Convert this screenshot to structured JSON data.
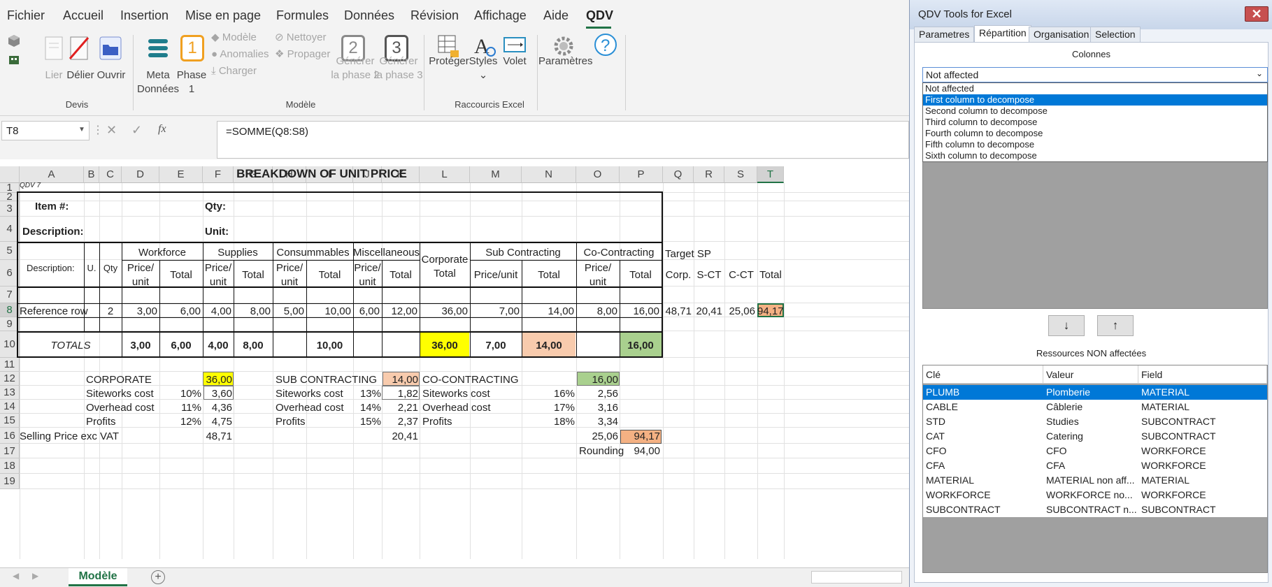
{
  "menu": [
    "Fichier",
    "Accueil",
    "Insertion",
    "Mise en page",
    "Formules",
    "Données",
    "Révision",
    "Affichage",
    "Aide",
    "QDV"
  ],
  "ribbon": {
    "devis": {
      "lier": "Lier",
      "delier": "Délier",
      "ouvrir": "Ouvrir",
      "group": "Devis"
    },
    "modele": {
      "meta1": "Meta",
      "meta2": "Données",
      "phase1a": "Phase",
      "phase1b": "1",
      "phase1_num": "1",
      "modele": "Modèle",
      "anomalies": "Anomalies",
      "charger": "Charger",
      "nettoyer": "Nettoyer",
      "propager": "Propager",
      "gen2a": "Générer",
      "gen2b": "la phase 2",
      "gen2_num": "2",
      "gen3a": "Générer",
      "gen3b": "la phase 3",
      "gen3_num": "3",
      "group": "Modèle"
    },
    "raccourcis": {
      "proteger": "Protéger",
      "styles": "Styles",
      "volet": "Volet",
      "group": "Raccourcis Excel"
    },
    "parametres": "Paramètres"
  },
  "formula_bar": {
    "name_box": "T8",
    "formula": "=SOMME(Q8:S8)",
    "fx": "fx"
  },
  "columns": [
    "A",
    "B",
    "C",
    "D",
    "E",
    "F",
    "G",
    "H",
    "I",
    "J",
    "K",
    "L",
    "M",
    "N",
    "O",
    "P",
    "Q",
    "R",
    "S",
    "T"
  ],
  "rows": [
    "1",
    "2",
    "3",
    "4",
    "5",
    "6",
    "7",
    "8",
    "9",
    "10",
    "11",
    "12",
    "13",
    "14",
    "15",
    "16",
    "17",
    "18",
    "19"
  ],
  "sheet": {
    "title": "BREAKDOWN OF UNIT PRICE",
    "qdv7": "QDV 7",
    "item": "Item #:",
    "qty": "Qty:",
    "description4": "Description:",
    "unit": "Unit:",
    "h_description": "Description:",
    "h_u": "U.",
    "h_qty": "Qty",
    "h_workforce": "Workforce",
    "h_supplies": "Supplies",
    "h_consumables": "Consummables",
    "h_misc": "Miscellaneous",
    "h_corp1": "Corporate",
    "h_corp2": "Total",
    "h_sub": "Sub Contracting",
    "h_co": "Co-Contracting",
    "h_target": "Target SP",
    "pu1": "Price/",
    "pu2": "unit",
    "total": "Total",
    "priceunit": "Price/unit",
    "corp": "Corp.",
    "sct": "S-CT",
    "cct": "C-CT",
    "ref_label": "Reference row",
    "ref_qty": "2",
    "ref": [
      "3,00",
      "6,00",
      "4,00",
      "8,00",
      "5,00",
      "10,00",
      "6,00",
      "12,00",
      "36,00",
      "7,00",
      "14,00",
      "8,00",
      "16,00",
      "48,71",
      "20,41",
      "25,06",
      "94,17"
    ],
    "totals_label": "TOTALS",
    "totals": [
      "3,00",
      "6,00",
      "4,00",
      "8,00",
      "10,00",
      "36,00",
      "7,00",
      "14,00",
      "16,00"
    ],
    "corporate": {
      "label": "CORPORATE",
      "value": "36,00",
      "sw": "Siteworks cost",
      "sw_pct": "10%",
      "sw_val": "3,60",
      "oh": "Overhead cost",
      "oh_pct": "11%",
      "oh_val": "4,36",
      "pr": "Profits",
      "pr_pct": "12%",
      "pr_val": "4,75",
      "sp_val": "48,71"
    },
    "subcontracting": {
      "label": "SUB CONTRACTING",
      "value": "14,00",
      "sw": "Siteworks cost",
      "sw_pct": "13%",
      "sw_val": "1,82",
      "oh": "Overhead cost",
      "oh_pct": "14%",
      "oh_val": "2,21",
      "pr": "Profits",
      "pr_pct": "15%",
      "pr_val": "2,37",
      "sp_val": "20,41"
    },
    "cocontracting": {
      "label": "CO-CONTRACTING",
      "value": "16,00",
      "sw": "Siteworks cost",
      "sw_pct": "16%",
      "sw_val": "2,56",
      "oh": "Overhead cost",
      "oh_pct": "17%",
      "oh_val": "3,16",
      "pr": "Profits",
      "pr_pct": "18%",
      "pr_val": "3,34",
      "sp_val": "25,06"
    },
    "selling": "Selling Price  exc VAT",
    "grand_total": "94,17",
    "rounding": "Rounding",
    "rounding_val": "94,00"
  },
  "sheet_tab": "Modèle",
  "panel": {
    "title": "QDV Tools for Excel",
    "close": "✕",
    "tabs": [
      "Parametres",
      "Répartition",
      "Organisation",
      "Selection"
    ],
    "colonnes": "Colonnes",
    "combo_value": "Not affected",
    "options": [
      "Not affected",
      "First column to decompose",
      "Second column to decompose",
      "Third column to decompose",
      "Fourth column to decompose",
      "Fifth column to decompose",
      "Sixth column to decompose"
    ],
    "down": "↓",
    "up": "↑",
    "ressources": "Ressources NON affectées",
    "headers": [
      "Clé",
      "Valeur",
      "Field"
    ],
    "resources": [
      [
        "PLUMB",
        "Plomberie",
        "MATERIAL"
      ],
      [
        "CABLE",
        "Câblerie",
        "MATERIAL"
      ],
      [
        "STD",
        "Studies",
        "SUBCONTRACT"
      ],
      [
        "CAT",
        "Catering",
        "SUBCONTRACT"
      ],
      [
        "CFO",
        "CFO",
        "WORKFORCE"
      ],
      [
        "CFA",
        "CFA",
        "WORKFORCE"
      ],
      [
        "MATERIAL",
        "MATERIAL non aff...",
        "MATERIAL"
      ],
      [
        "WORKFORCE",
        "WORKFORCE no...",
        "WORKFORCE"
      ],
      [
        "SUBCONTRACT",
        "SUBCONTRACT n...",
        "SUBCONTRACT"
      ]
    ]
  },
  "colors": {
    "accent": "#217346",
    "yellow": "#ffff00",
    "salmon": "#f8cbad",
    "green": "#a9d08e",
    "orange": "#f4b183",
    "select": "#0078d7"
  }
}
